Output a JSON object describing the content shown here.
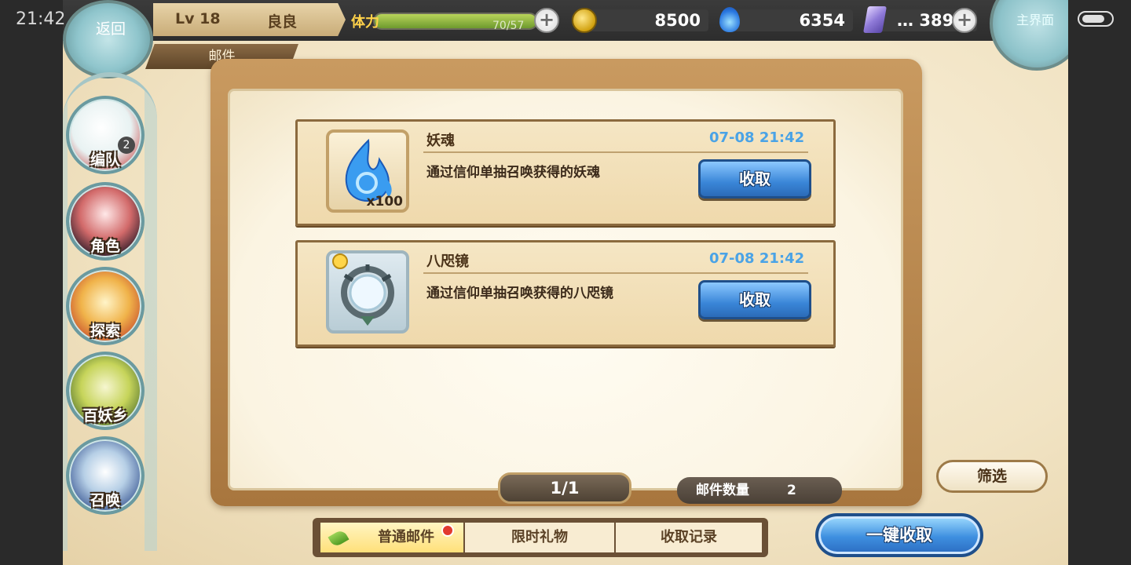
{
  "status_bar": {
    "time": "21:42"
  },
  "top": {
    "back_label": "返回",
    "level": "Lv 18",
    "player_name": "良良",
    "section_tab": "邮件",
    "stamina_label": "体力",
    "stamina_value": "70/57",
    "stamina_progress": 1.0,
    "gold": "8500",
    "souls": "6354",
    "gems": "389",
    "gems_overlay": "… 389 s",
    "topright_label": "主界面"
  },
  "sidebar": {
    "items": [
      {
        "label": "编队",
        "badge": "2"
      },
      {
        "label": "角色"
      },
      {
        "label": "探索"
      },
      {
        "label": "百妖乡"
      },
      {
        "label": "召唤"
      }
    ]
  },
  "mails": [
    {
      "title": "妖魂",
      "date": "07-08 21:42",
      "desc": "通过信仰单抽召唤获得的妖魂",
      "qty": "x100",
      "collect": "收取",
      "icon": "blue-soul-flame-icon"
    },
    {
      "title": "八咫镜",
      "date": "07-08 21:42",
      "desc": "通过信仰单抽召唤获得的八咫镜",
      "qty": "",
      "collect": "收取",
      "icon": "yata-mirror-icon"
    }
  ],
  "pager": "1/1",
  "mail_count_label": "邮件数量",
  "mail_count": "2",
  "filter_label": "筛选",
  "tabs": [
    {
      "label": "普通邮件",
      "active": true,
      "has_notice": true
    },
    {
      "label": "限时礼物",
      "active": false
    },
    {
      "label": "收取记录",
      "active": false
    }
  ],
  "collect_all_label": "一键收取",
  "colors": {
    "accent_blue": "#3a86d8",
    "date_blue": "#4aa3e6",
    "board_wood": "#b8864b"
  }
}
